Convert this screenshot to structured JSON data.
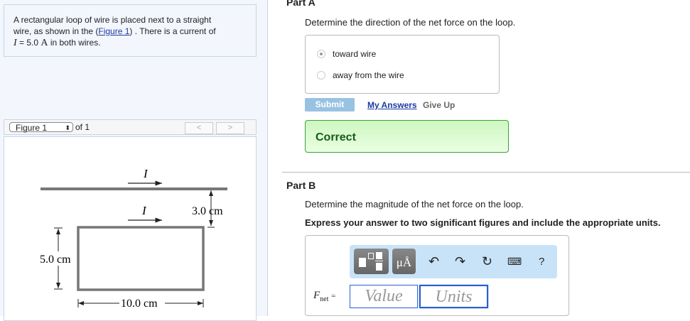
{
  "problem": {
    "text1": "A rectangular loop of wire is placed next to a straight",
    "text2": "wire, as shown in the (",
    "link": "Figure 1",
    "text3": ") . There is a current of",
    "var": "I",
    "eq": " = 5.0 ",
    "unit": "A",
    "text4": " in both wires."
  },
  "figure_nav": {
    "select": "Figure 1",
    "of": "of 1",
    "prev": "<",
    "next": ">"
  },
  "diagram": {
    "current_label": "I",
    "gap": "3.0 cm",
    "height": "5.0 cm",
    "width": "10.0 cm"
  },
  "partA": {
    "title": "Part A",
    "question": "Determine the direction of the net force on the loop.",
    "options": [
      "toward wire",
      "away from the wire"
    ],
    "selected": 0,
    "submit": "Submit",
    "my_answers": "My Answers",
    "give_up": "Give Up",
    "feedback": "Correct"
  },
  "partB": {
    "title": "Part B",
    "question": "Determine the magnitude of the net force on the loop.",
    "instruction": "Express your answer to two significant figures and include the appropriate units.",
    "units_btn": "μÅ",
    "help": "?",
    "var": "F",
    "sub": "net",
    "eq": "=",
    "value_ph": "Value",
    "units_ph": "Units"
  },
  "colors": {
    "correct_bg": "#d8fbcc",
    "link": "#1a3aa0",
    "toolbar": "#c8e3f8"
  }
}
